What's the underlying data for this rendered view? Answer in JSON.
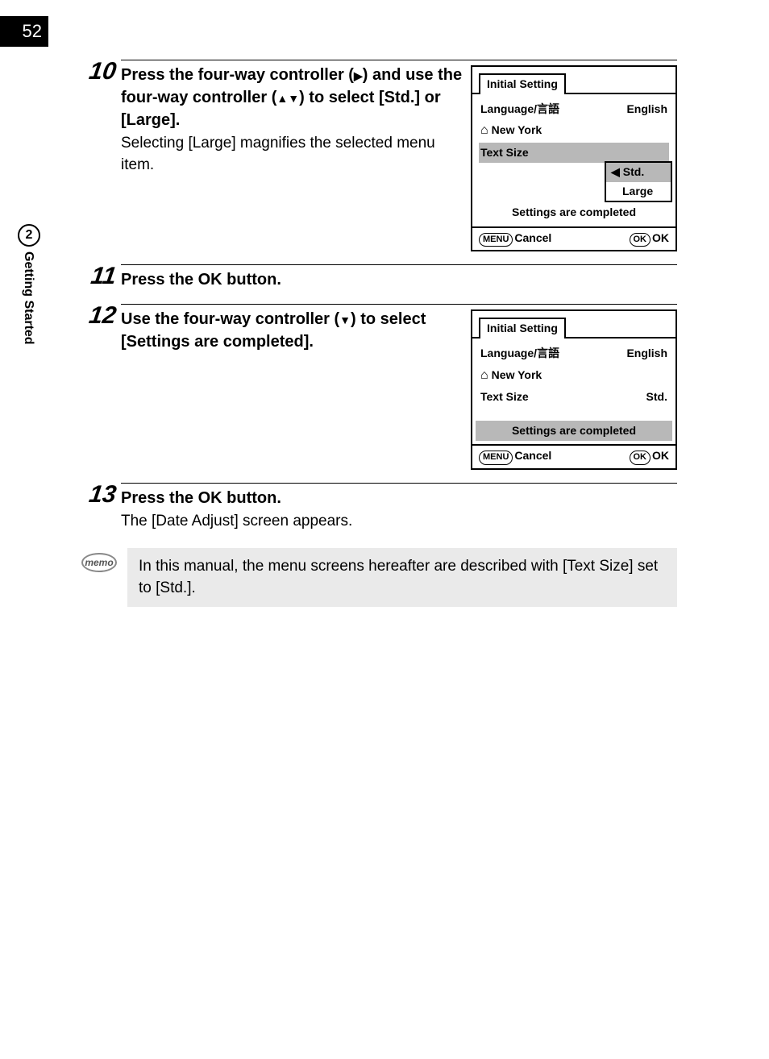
{
  "page_number": "52",
  "side_tab": {
    "chapter": "2",
    "label": "Getting Started"
  },
  "steps": {
    "s10": {
      "num": "10",
      "heading_a": "Press the four-way controller (",
      "heading_b": ") and use the four-way controller (",
      "heading_c": ") to select [Std.] or [Large].",
      "sub": "Selecting [Large] magnifies the selected menu item."
    },
    "s11": {
      "num": "11",
      "heading": "Press the OK button."
    },
    "s12": {
      "num": "12",
      "heading_a": "Use the four-way controller (",
      "heading_b": ") to select [Settings are completed]."
    },
    "s13": {
      "num": "13",
      "heading": "Press the OK button.",
      "sub": "The [Date Adjust] screen appears."
    }
  },
  "screens": {
    "a": {
      "title": "Initial Setting",
      "lang_label": "Language/言語",
      "lang_value": "English",
      "city": "New York",
      "textsize_label": "Text Size",
      "opt_std": "Std.",
      "opt_large": "Large",
      "completed": "Settings are completed",
      "menu": "MENU",
      "cancel": "Cancel",
      "ok_pill": "OK",
      "ok": "OK"
    },
    "b": {
      "title": "Initial Setting",
      "lang_label": "Language/言語",
      "lang_value": "English",
      "city": "New York",
      "textsize_label": "Text Size",
      "textsize_value": "Std.",
      "completed": "Settings are completed",
      "menu": "MENU",
      "cancel": "Cancel",
      "ok_pill": "OK",
      "ok": "OK"
    }
  },
  "memo": {
    "icon": "memo",
    "text": "In this manual, the menu screens hereafter are described with [Text Size] set to [Std.]."
  },
  "glyphs": {
    "right": "▶",
    "up": "▲",
    "down": "▼",
    "left_small": "◀",
    "home": "⌂"
  }
}
